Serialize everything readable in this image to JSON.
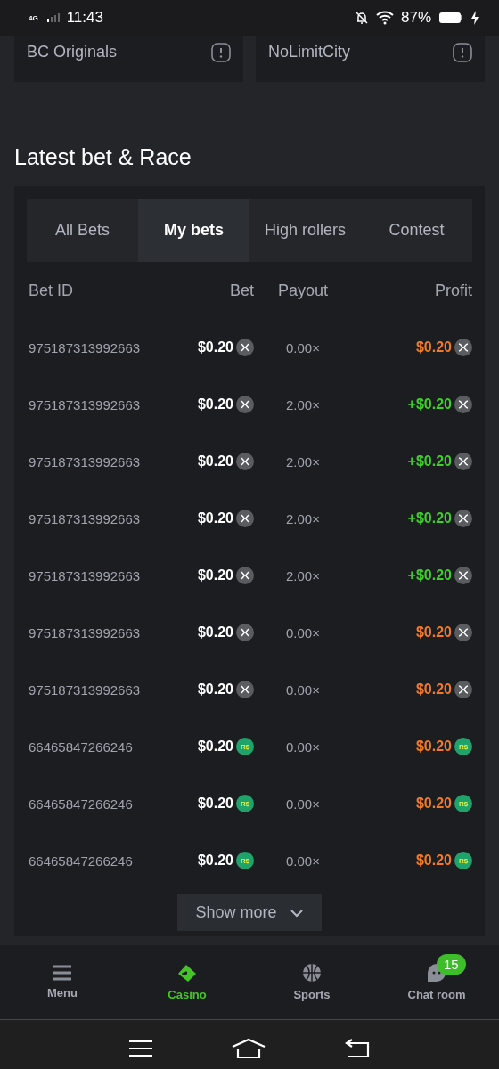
{
  "status_bar": {
    "network": "4G",
    "time": "11:43",
    "battery": "87%"
  },
  "providers": [
    {
      "name": "BC Originals"
    },
    {
      "name": "NoLimitCity"
    }
  ],
  "section_title": "Latest bet & Race",
  "tabs": [
    {
      "label": "All Bets",
      "selected": false
    },
    {
      "label": "My bets",
      "selected": true
    },
    {
      "label": "High rollers",
      "selected": false
    },
    {
      "label": "Contest",
      "selected": false
    }
  ],
  "table": {
    "columns": [
      "Bet ID",
      "Bet",
      "Payout",
      "Profit"
    ],
    "rows": [
      {
        "bet_id": "975187313992663",
        "bet": "$0.20",
        "bet_coin": {
          "kind": "x"
        },
        "payout": "0.00×",
        "profit": "$0.20",
        "win": false,
        "profit_coin": {
          "kind": "x"
        }
      },
      {
        "bet_id": "975187313992663",
        "bet": "$0.20",
        "bet_coin": {
          "kind": "x"
        },
        "payout": "2.00×",
        "profit": "+$0.20",
        "win": true,
        "profit_coin": {
          "kind": "x"
        }
      },
      {
        "bet_id": "975187313992663",
        "bet": "$0.20",
        "bet_coin": {
          "kind": "x"
        },
        "payout": "2.00×",
        "profit": "+$0.20",
        "win": true,
        "profit_coin": {
          "kind": "x"
        }
      },
      {
        "bet_id": "975187313992663",
        "bet": "$0.20",
        "bet_coin": {
          "kind": "x"
        },
        "payout": "2.00×",
        "profit": "+$0.20",
        "win": true,
        "profit_coin": {
          "kind": "x"
        }
      },
      {
        "bet_id": "975187313992663",
        "bet": "$0.20",
        "bet_coin": {
          "kind": "x"
        },
        "payout": "2.00×",
        "profit": "+$0.20",
        "win": true,
        "profit_coin": {
          "kind": "x"
        }
      },
      {
        "bet_id": "975187313992663",
        "bet": "$0.20",
        "bet_coin": {
          "kind": "x"
        },
        "payout": "0.00×",
        "profit": "$0.20",
        "win": false,
        "profit_coin": {
          "kind": "x"
        }
      },
      {
        "bet_id": "975187313992663",
        "bet": "$0.20",
        "bet_coin": {
          "kind": "x"
        },
        "payout": "0.00×",
        "profit": "$0.20",
        "win": false,
        "profit_coin": {
          "kind": "x"
        }
      },
      {
        "bet_id": "66465847266246",
        "bet": "$0.20",
        "bet_coin": {
          "kind": "label",
          "label": "R$"
        },
        "payout": "0.00×",
        "profit": "$0.20",
        "win": false,
        "profit_coin": {
          "kind": "label",
          "label": "R$"
        }
      },
      {
        "bet_id": "66465847266246",
        "bet": "$0.20",
        "bet_coin": {
          "kind": "label",
          "label": "R$"
        },
        "payout": "0.00×",
        "profit": "$0.20",
        "win": false,
        "profit_coin": {
          "kind": "label",
          "label": "R$"
        }
      },
      {
        "bet_id": "66465847266246",
        "bet": "$0.20",
        "bet_coin": {
          "kind": "label",
          "label": "R$"
        },
        "payout": "0.00×",
        "profit": "$0.20",
        "win": false,
        "profit_coin": {
          "kind": "label",
          "label": "R$"
        }
      }
    ]
  },
  "show_more": "Show more",
  "bottom_nav": [
    {
      "label": "Menu",
      "kind": "menu",
      "selected": false
    },
    {
      "label": "Casino",
      "kind": "cards",
      "selected": true
    },
    {
      "label": "Sports",
      "kind": "ball",
      "selected": false
    },
    {
      "label": "Chat room",
      "kind": "chat",
      "selected": false,
      "badge": "15"
    }
  ]
}
